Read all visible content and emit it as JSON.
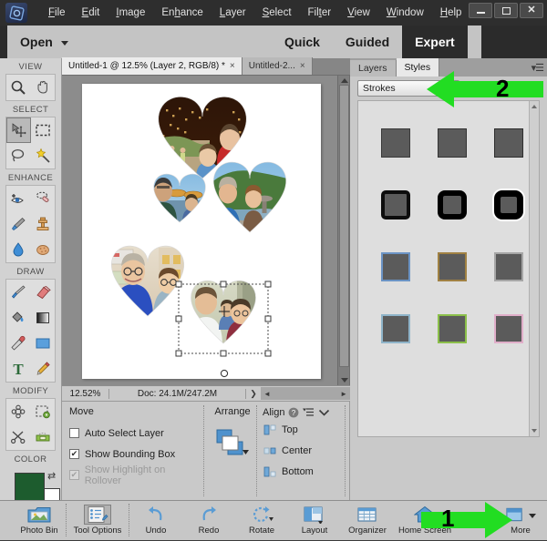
{
  "window": {
    "logo_icon": "photoshop-elements-logo",
    "controls": [
      {
        "name": "minimize",
        "glyph": "–"
      },
      {
        "name": "maximize",
        "glyph": "▢"
      },
      {
        "name": "close",
        "glyph": "✕"
      }
    ]
  },
  "menubar": {
    "items": [
      {
        "label": "File",
        "accel": "F"
      },
      {
        "label": "Edit",
        "accel": "E"
      },
      {
        "label": "Image",
        "accel": "I"
      },
      {
        "label": "Enhance",
        "accel": "h"
      },
      {
        "label": "Layer",
        "accel": "L"
      },
      {
        "label": "Select",
        "accel": "S"
      },
      {
        "label": "Filter",
        "accel": "t"
      },
      {
        "label": "View",
        "accel": "V"
      },
      {
        "label": "Window",
        "accel": "W"
      },
      {
        "label": "Help",
        "accel": "H"
      }
    ]
  },
  "modebar": {
    "open_label": "Open",
    "modes": [
      {
        "label": "Quick",
        "active": false
      },
      {
        "label": "Guided",
        "active": false
      },
      {
        "label": "Expert",
        "active": true
      }
    ]
  },
  "toolbar": {
    "sections": [
      {
        "label": "VIEW",
        "tools": [
          {
            "name": "zoom-tool",
            "icon": "magnifier-icon",
            "selected": false
          },
          {
            "name": "hand-tool",
            "icon": "hand-icon",
            "selected": false
          }
        ]
      },
      {
        "label": "SELECT",
        "tools": [
          {
            "name": "move-tool",
            "icon": "move-icon",
            "selected": true
          },
          {
            "name": "marquee-tool",
            "icon": "rectangular-marquee-icon",
            "selected": false
          },
          {
            "name": "lasso-tool",
            "icon": "lasso-icon",
            "selected": false
          },
          {
            "name": "quick-selection-tool",
            "icon": "magic-wand-icon",
            "selected": false
          }
        ]
      },
      {
        "label": "ENHANCE",
        "tools": [
          {
            "name": "red-eye-tool",
            "icon": "eye-icon",
            "selected": false
          },
          {
            "name": "spot-healing-tool",
            "icon": "healing-brush-icon",
            "selected": false
          },
          {
            "name": "smart-brush-tool",
            "icon": "smart-brush-icon",
            "selected": false
          },
          {
            "name": "clone-stamp-tool",
            "icon": "clone-stamp-icon",
            "selected": false
          },
          {
            "name": "blur-tool",
            "icon": "water-drop-icon",
            "selected": false
          },
          {
            "name": "sponge-tool",
            "icon": "sponge-icon",
            "selected": false
          }
        ]
      },
      {
        "label": "DRAW",
        "tools": [
          {
            "name": "brush-tool",
            "icon": "paintbrush-icon",
            "selected": false
          },
          {
            "name": "eraser-tool",
            "icon": "eraser-icon",
            "selected": false
          },
          {
            "name": "paint-bucket-tool",
            "icon": "paint-bucket-icon",
            "selected": false
          },
          {
            "name": "gradient-tool",
            "icon": "gradient-icon",
            "selected": false
          },
          {
            "name": "eyedropper-tool",
            "icon": "eyedropper-icon",
            "selected": false
          },
          {
            "name": "shape-tool",
            "icon": "rectangle-shape-icon",
            "selected": false
          },
          {
            "name": "type-tool",
            "icon": "type-t-icon",
            "selected": false
          },
          {
            "name": "pencil-tool",
            "icon": "pencil-icon",
            "selected": false
          }
        ]
      },
      {
        "label": "MODIFY",
        "tools": [
          {
            "name": "cookie-cutter-tool",
            "icon": "flower-shape-icon",
            "selected": false
          },
          {
            "name": "recompose-tool",
            "icon": "recompose-icon",
            "selected": false
          },
          {
            "name": "content-aware-move-tool",
            "icon": "scissors-icon",
            "selected": false
          },
          {
            "name": "straighten-tool",
            "icon": "straighten-icon",
            "selected": false
          }
        ]
      }
    ],
    "color_section_label": "COLOR",
    "foreground_color": "#1d5c2e",
    "background_color": "#ffffff"
  },
  "documents": {
    "tabs": [
      {
        "label": "Untitled-1 @ 12.5% (Layer 2, RGB/8) *",
        "active": true,
        "close": "×"
      },
      {
        "label": "Untitled-2...",
        "active": false,
        "close": "×"
      }
    ]
  },
  "status": {
    "zoom": "12.52%",
    "doc_size": "Doc: 24.1M/247.2M",
    "expand_glyph": "❯"
  },
  "tool_options": {
    "title": "Move",
    "checkboxes": [
      {
        "label": "Auto Select Layer",
        "checked": false,
        "disabled": false
      },
      {
        "label": "Show Bounding Box",
        "checked": true,
        "disabled": false
      },
      {
        "label": "Show Highlight on Rollover",
        "checked": true,
        "disabled": true
      }
    ],
    "arrange_label": "Arrange",
    "align_label": "Align",
    "align_help_icon": "question-mark-icon",
    "align_menu_icon": "flyout-menu-icon",
    "align_collapse_icon": "chevron-down-icon",
    "align_items": [
      {
        "label": "Top",
        "icon": "align-top-icon"
      },
      {
        "label": "Center",
        "icon": "align-center-icon"
      },
      {
        "label": "Bottom",
        "icon": "align-bottom-icon"
      }
    ]
  },
  "right_panel": {
    "tabs": [
      {
        "label": "Layers",
        "active": false
      },
      {
        "label": "Styles",
        "active": true
      }
    ],
    "panel_menu_icon": "panel-menu-icon",
    "style_category": "Strokes",
    "styles": [
      {
        "name": "stroke-thin-dark-1",
        "border": "1px solid #3a3a3a",
        "radius": "0px",
        "shadow": "none",
        "size": 32
      },
      {
        "name": "stroke-thin-dark-2",
        "border": "1.5px solid #333333",
        "radius": "0px",
        "shadow": "none",
        "size": 32
      },
      {
        "name": "stroke-thin-dark-3",
        "border": "1.5px solid #2e2e2e",
        "radius": "0px",
        "shadow": "none",
        "size": 32
      },
      {
        "name": "stroke-thick-rounded-1",
        "border": "4px solid #0d0d0d",
        "radius": "5px",
        "shadow": "none",
        "size": 32
      },
      {
        "name": "stroke-thick-rounded-2",
        "border": "6px solid #000000",
        "radius": "8px",
        "shadow": "none",
        "size": 32
      },
      {
        "name": "stroke-thick-rounded-3",
        "border": "7px solid #000000",
        "radius": "9px",
        "shadow": "0 0 0 2px #ffffff",
        "size": 32
      },
      {
        "name": "stroke-blue",
        "border": "2px solid #6b93c4",
        "radius": "0px",
        "shadow": "none",
        "size": 32
      },
      {
        "name": "stroke-tan",
        "border": "2px solid #a08143",
        "radius": "0px",
        "shadow": "none",
        "size": 32
      },
      {
        "name": "stroke-gray",
        "border": "2px solid #a6a6a6",
        "radius": "0px",
        "shadow": "none",
        "size": 32
      },
      {
        "name": "stroke-lightblue-green",
        "border": "2px solid #8fb4c9",
        "radius": "0px",
        "shadow": "none",
        "size": 32
      },
      {
        "name": "stroke-green",
        "border": "2px solid #8bbf4a",
        "radius": "0px",
        "shadow": "none",
        "size": 32
      },
      {
        "name": "stroke-pink",
        "border": "2px solid #e0aec9",
        "radius": "0px",
        "shadow": "none",
        "size": 32
      }
    ]
  },
  "taskbar": {
    "items": [
      {
        "label": "Photo Bin",
        "icon": "photo-bin-icon",
        "selected": false
      },
      {
        "label": "Tool Options",
        "icon": "tool-options-icon",
        "selected": true
      },
      {
        "label": "Undo",
        "icon": "undo-arrow-icon",
        "selected": false
      },
      {
        "label": "Redo",
        "icon": "redo-arrow-icon",
        "selected": false
      },
      {
        "label": "Rotate",
        "icon": "rotate-icon",
        "selected": false
      },
      {
        "label": "Layout",
        "icon": "layout-icon",
        "selected": false
      },
      {
        "label": "Organizer",
        "icon": "organizer-grid-icon",
        "selected": false
      },
      {
        "label": "Home Screen",
        "icon": "home-house-icon",
        "selected": false
      }
    ],
    "more": {
      "label": "More",
      "icon": "more-panel-icon"
    }
  },
  "callouts": [
    {
      "number": "1",
      "direction": "right",
      "target": "more-button",
      "color": "#22dd22"
    },
    {
      "number": "2",
      "direction": "left",
      "target": "style-category-dropdown",
      "color": "#22dd22"
    }
  ],
  "canvas": {
    "selection_handles": 8,
    "rotate_handle_icon": "rotate-handle-icon"
  }
}
